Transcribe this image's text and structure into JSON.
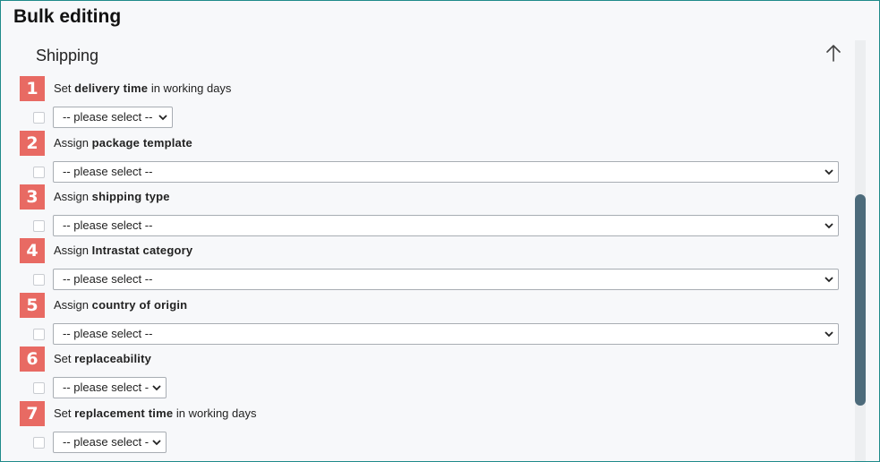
{
  "page": {
    "title": "Bulk editing"
  },
  "section": {
    "title": "Shipping"
  },
  "items": [
    {
      "num": "1",
      "pre": "Set ",
      "bold": "delivery time",
      "post": " in working days",
      "select": "-- please select --"
    },
    {
      "num": "2",
      "pre": "Assign ",
      "bold": "package template",
      "post": "",
      "select": "-- please select --"
    },
    {
      "num": "3",
      "pre": "Assign ",
      "bold": "shipping type",
      "post": "",
      "select": "-- please select --"
    },
    {
      "num": "4",
      "pre": "Assign ",
      "bold": "Intrastat category",
      "post": "",
      "select": "-- please select --"
    },
    {
      "num": "5",
      "pre": "Assign ",
      "bold": "country of origin",
      "post": "",
      "select": "-- please select --"
    },
    {
      "num": "6",
      "pre": "Set ",
      "bold": "replaceability",
      "post": "",
      "select": "-- please select -"
    },
    {
      "num": "7",
      "pre": "Set ",
      "bold": "replacement time",
      "post": " in working days",
      "select": "-- please select -"
    }
  ],
  "icons": {
    "collapse": "arrow-up-icon",
    "dropdown": "chevron-down-icon"
  },
  "colors": {
    "badge": "#e86a63",
    "scrollbar": "#4d6b7b",
    "frame": "#1f8a8a"
  }
}
